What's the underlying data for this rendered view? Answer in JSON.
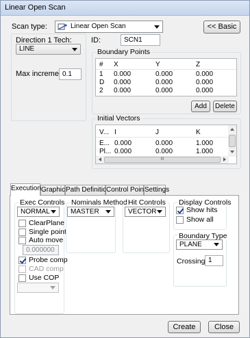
{
  "window": {
    "title": "Linear Open Scan"
  },
  "top": {
    "scan_type_label": "Scan type:",
    "scan_type_value": "Linear Open Scan",
    "basic_button": "<< Basic",
    "direction_label": "Direction 1 Tech:",
    "direction_value": "LINE",
    "id_label": "ID:",
    "id_value": "SCN1",
    "max_increment_label": "Max increment:",
    "max_increment_value": "0.1"
  },
  "boundary_points": {
    "title": "Boundary Points",
    "columns": [
      "#",
      "X",
      "Y",
      "Z"
    ],
    "rows": [
      [
        "1",
        "0.000",
        "0.000",
        "0.000"
      ],
      [
        "D",
        "0.000",
        "0.000",
        "0.000"
      ],
      [
        "2",
        "0.000",
        "0.000",
        "0.000"
      ]
    ],
    "add_button": "Add",
    "delete_button": "Delete"
  },
  "initial_vectors": {
    "title": "Initial Vectors",
    "columns": [
      "V...",
      "I",
      "J",
      "K"
    ],
    "rows": [
      [
        "E...",
        "0.000",
        "0.000",
        "1.000"
      ],
      [
        "Pl...",
        "0.000",
        "0.000",
        "1.000"
      ]
    ],
    "hscroll_grip": "III"
  },
  "tabs": [
    "Execution",
    "Graphics",
    "Path Definition",
    "Control Points",
    "Settings"
  ],
  "execution": {
    "exec_controls": {
      "title": "Exec Controls",
      "mode_value": "NORMAL",
      "clear_plane": "ClearPlane",
      "single_point": "Single point",
      "auto_move": "Auto move",
      "auto_move_value": "0.000000",
      "probe_comp": "Probe comp",
      "cad_comp": "CAD comp",
      "use_cop": "Use COP"
    },
    "nominals": {
      "title": "Nominals Method",
      "value": "MASTER"
    },
    "hit_controls": {
      "title": "Hit Controls",
      "value": "VECTOR"
    },
    "display_controls": {
      "title": "Display Controls",
      "show_hits": "Show hits",
      "show_all": "Show all"
    },
    "boundary_type": {
      "title": "Boundary Type",
      "value": "PLANE",
      "crossings_label": "Crossings:",
      "crossings_value": "1"
    }
  },
  "footer": {
    "create_button": "Create",
    "close_button": "Close"
  },
  "colors": {
    "title_gradient_top": "#dbe6f5",
    "title_gradient_bottom": "#c5d5ec",
    "check_mark": "#1b3e8c"
  }
}
